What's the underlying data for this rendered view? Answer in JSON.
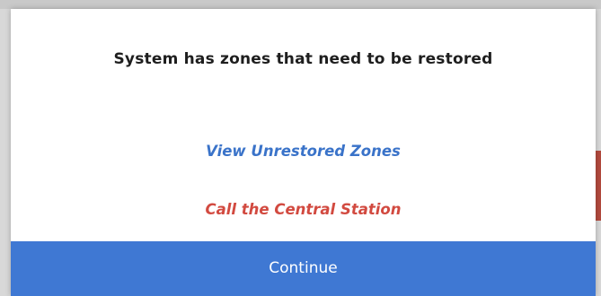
{
  "dialog": {
    "title": "System has zones that need to be restored",
    "links": {
      "view_unrestored_zones": "View Unrestored Zones",
      "call_central_station": "Call the Central Station"
    },
    "continue_label": "Continue"
  },
  "colors": {
    "link_blue": "#3a73c9",
    "link_red": "#d24a40",
    "button_blue": "#3f78d3"
  }
}
